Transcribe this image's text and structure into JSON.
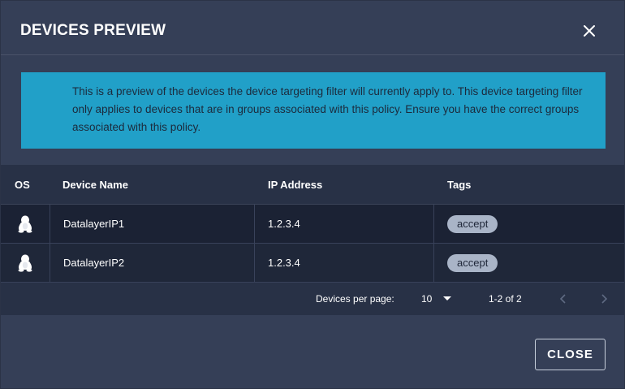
{
  "dialog": {
    "title": "DEVICES PREVIEW",
    "close_icon": "close-icon"
  },
  "banner": {
    "text": "This is a preview of the devices the device targeting filter will currently apply to. This device targeting filter only applies to devices that are in groups associated with this policy. Ensure you have the correct groups associated with this policy.",
    "color": "#21a0c8"
  },
  "table": {
    "columns": [
      "OS",
      "Device Name",
      "IP Address",
      "Tags"
    ],
    "rows": [
      {
        "os_icon": "linux-tux-icon",
        "device_name": "DatalayerIP1",
        "ip": "1.2.3.4",
        "tag": "accept"
      },
      {
        "os_icon": "linux-tux-icon",
        "device_name": "DatalayerIP2",
        "ip": "1.2.3.4",
        "tag": "accept"
      }
    ]
  },
  "pagination": {
    "per_page_label": "Devices per page:",
    "per_page_value": "10",
    "range": "1-2 of 2",
    "prev_icon": "chevron-left-icon",
    "next_icon": "chevron-right-icon"
  },
  "actions": {
    "close_label": "CLOSE"
  }
}
